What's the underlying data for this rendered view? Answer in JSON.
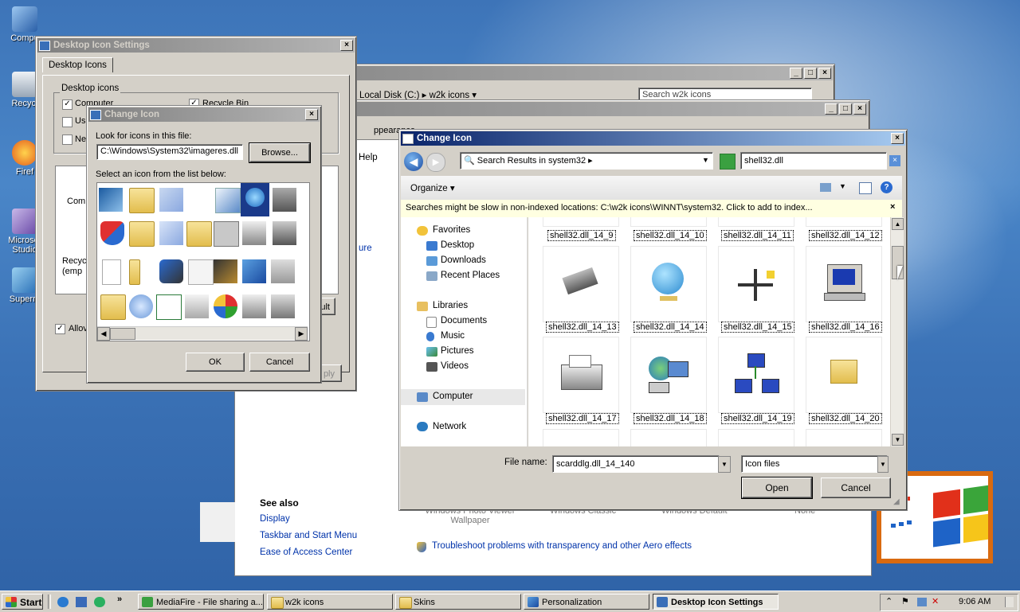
{
  "desktop": {
    "icons": [
      {
        "label": "Compu",
        "name": "computer"
      },
      {
        "label": "Recycl",
        "name": "recycle-bin"
      },
      {
        "label": "Firef",
        "name": "firefox"
      },
      {
        "label": "Microsof Studio",
        "name": "visual-studio"
      },
      {
        "label": "Superm",
        "name": "superm"
      }
    ]
  },
  "back_explorer_1": {
    "path_drive": "Local Disk (C:)",
    "path_folder": "w2k icons",
    "search_placeholder": "Search w2k icons"
  },
  "back_explorer_2": {
    "tab_fragment": "ppearance",
    "help": "Help",
    "fragment": "ure"
  },
  "personalization": {
    "see_also": "See also",
    "links": [
      "Display",
      "Taskbar and Start Menu",
      "Ease of Access Center"
    ],
    "theme_labels": [
      "Windows Photo Viewer Wallpaper",
      "Windows Classic",
      "Windows Default",
      "None"
    ],
    "troubleshoot": "Troubleshoot problems with transparency and other Aero effects"
  },
  "desktop_icon_settings": {
    "title": "Desktop Icon Settings",
    "tab": "Desktop Icons",
    "group": "Desktop icons",
    "cb_computer": "Computer",
    "cb_recycle": "Recycle Bin",
    "cb_user_frag": "Us",
    "cb_network_frag": "Ne",
    "list_frag_1": "Comp",
    "list_frag_2": "Recyc (emp",
    "default_frag": "ault",
    "allow_frag": "Allov",
    "apply_frag": "ply"
  },
  "change_icon_small": {
    "title": "Change Icon",
    "look_label": "Look for icons in this file:",
    "file_path": "C:\\Windows\\System32\\imageres.dll",
    "browse": "Browse...",
    "select_label": "Select an icon from the list below:",
    "ok": "OK",
    "cancel": "Cancel"
  },
  "change_icon_big": {
    "title": "Change Icon",
    "address": "Search Results in system32",
    "search_value": "shell32.dll",
    "organize": "Organize",
    "info_bar": "Searches might be slow in non-indexed locations: C:\\w2k icons\\WINNT\\system32. Click to add to index...",
    "nav": {
      "favorites": "Favorites",
      "fav_items": [
        "Desktop",
        "Downloads",
        "Recent Places"
      ],
      "libraries": "Libraries",
      "lib_items": [
        "Documents",
        "Music",
        "Pictures",
        "Videos"
      ],
      "computer": "Computer",
      "network": "Network"
    },
    "top_labels": [
      "shell32.dll_14_9",
      "shell32.dll_14_10",
      "shell32.dll_14_11",
      "shell32.dll_14_12"
    ],
    "row1_labels": [
      "shell32.dll_14_13",
      "shell32.dll_14_14",
      "shell32.dll_14_15",
      "shell32.dll_14_16"
    ],
    "row2_labels": [
      "shell32.dll_14_17",
      "shell32.dll_14_18",
      "shell32.dll_14_19",
      "shell32.dll_14_20"
    ],
    "file_name_label": "File name:",
    "file_name_value": "scarddlg.dll_14_140",
    "file_type": "Icon files",
    "open": "Open",
    "cancel": "Cancel"
  },
  "taskbar": {
    "start": "Start",
    "buttons": [
      "MediaFire - File sharing a...",
      "w2k icons",
      "Skins",
      "Personalization",
      "Desktop Icon Settings"
    ],
    "clock": "9:06 AM"
  }
}
